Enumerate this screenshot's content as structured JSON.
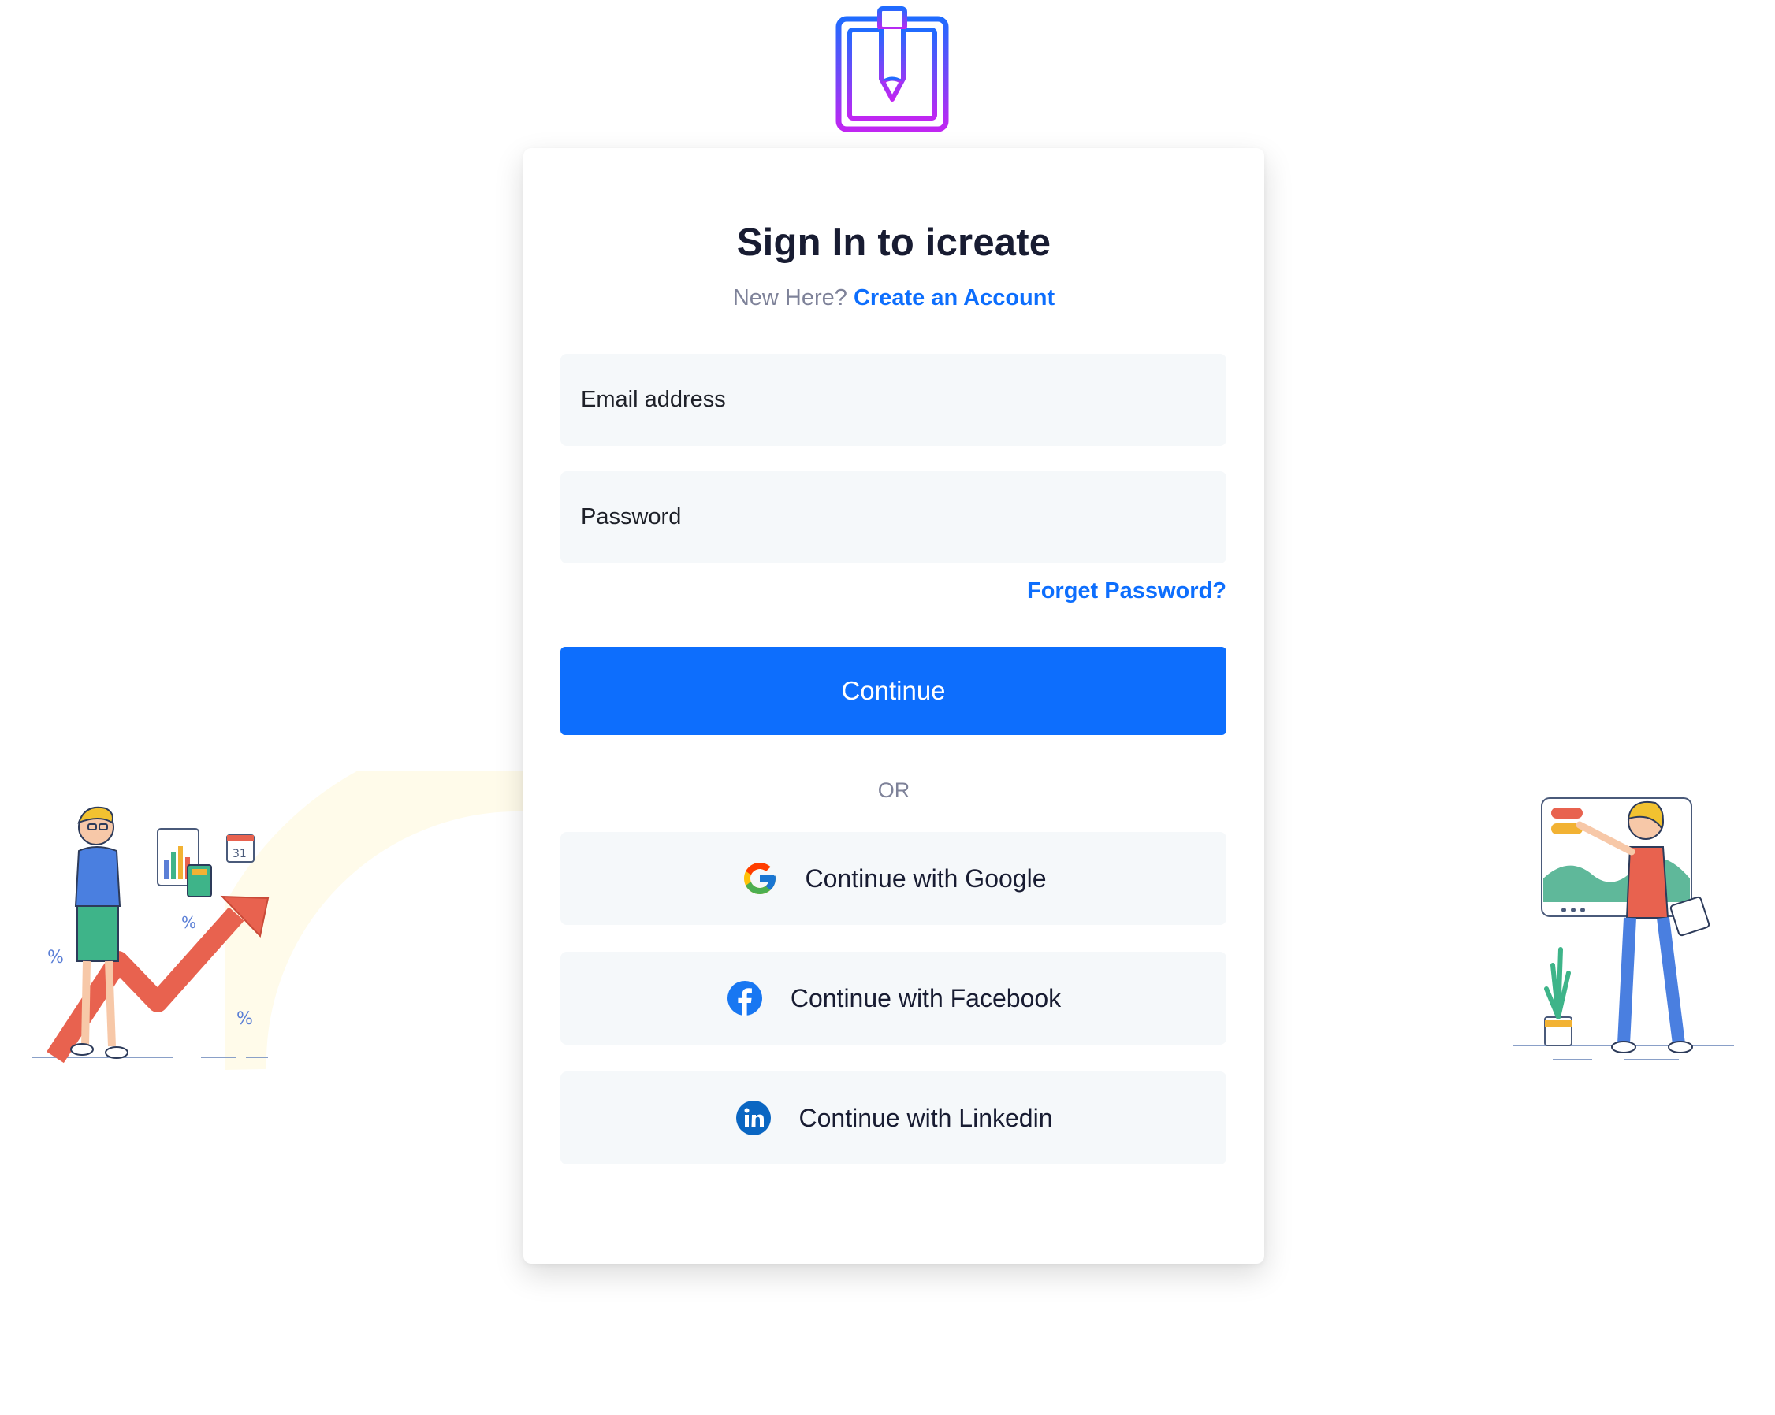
{
  "brand": {
    "logo_icon": "pencil-tablet-logo-icon"
  },
  "signin": {
    "title": "Sign In to icreate",
    "subtitle_prefix": "New Here?",
    "create_account_link": "Create an Account",
    "email_placeholder": "Email address",
    "password_placeholder": "Password",
    "forgot_password_link": "Forget Password?",
    "continue_button": "Continue",
    "or_separator": "OR"
  },
  "social": [
    {
      "label": "Continue with Google",
      "icon": "google-icon"
    },
    {
      "label": "Continue with Facebook",
      "icon": "facebook-icon"
    },
    {
      "label": "Continue with Linkedin",
      "icon": "linkedin-icon"
    }
  ],
  "colors": {
    "primary": "#0d6efd",
    "input_bg": "#f5f8fa",
    "title": "#181c32",
    "muted": "#7e8299",
    "logo_gradient_start": "#1f6bff",
    "logo_gradient_end": "#c026f2"
  }
}
